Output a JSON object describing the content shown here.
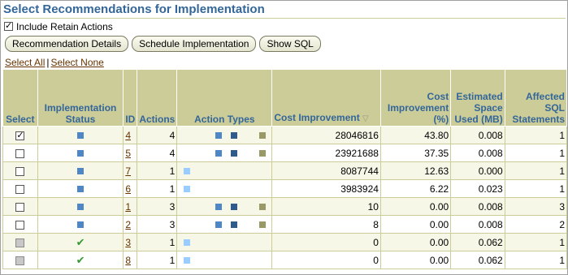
{
  "title": "Select Recommendations for Implementation",
  "retain": {
    "label": "Include Retain Actions",
    "checked": true
  },
  "buttons": {
    "details": "Recommendation Details",
    "schedule": "Schedule Implementation",
    "show_sql": "Show SQL"
  },
  "links": {
    "select_all": "Select All",
    "separator": "|",
    "select_none": "Select None"
  },
  "columns": {
    "select": "Select",
    "status": "Implementation Status",
    "id": "ID",
    "actions": "Actions",
    "action_types": "Action Types",
    "cost_improvement": "Cost Improvement",
    "cost_improvement_pct": "Cost Improvement (%)",
    "space": "Estimated Space Used (MB)",
    "affected": "Affected SQL Statements"
  },
  "rows": [
    {
      "selected": true,
      "disabled": false,
      "status": "pending",
      "id": "4",
      "actions": "4",
      "types": [
        "blue",
        "navy",
        "olive"
      ],
      "cost": "28046816",
      "pct": "43.80",
      "space": "0.008",
      "affected": "1"
    },
    {
      "selected": false,
      "disabled": false,
      "status": "pending",
      "id": "5",
      "actions": "4",
      "types": [
        "blue",
        "navy",
        "olive"
      ],
      "cost": "23921688",
      "pct": "37.35",
      "space": "0.008",
      "affected": "1"
    },
    {
      "selected": false,
      "disabled": false,
      "status": "pending",
      "id": "7",
      "actions": "1",
      "types": [
        "light"
      ],
      "cost": "8087744",
      "pct": "12.63",
      "space": "0.000",
      "affected": "1"
    },
    {
      "selected": false,
      "disabled": false,
      "status": "pending",
      "id": "6",
      "actions": "1",
      "types": [
        "light"
      ],
      "cost": "3983924",
      "pct": "6.22",
      "space": "0.023",
      "affected": "1"
    },
    {
      "selected": false,
      "disabled": false,
      "status": "pending",
      "id": "1",
      "actions": "3",
      "types": [
        "blue",
        "navy",
        "olive"
      ],
      "cost": "10",
      "pct": "0.00",
      "space": "0.008",
      "affected": "3"
    },
    {
      "selected": false,
      "disabled": false,
      "status": "pending",
      "id": "2",
      "actions": "3",
      "types": [
        "blue",
        "navy",
        "olive"
      ],
      "cost": "8",
      "pct": "0.00",
      "space": "0.008",
      "affected": "2"
    },
    {
      "selected": false,
      "disabled": true,
      "status": "implemented",
      "id": "3",
      "actions": "1",
      "types": [
        "light"
      ],
      "cost": "0",
      "pct": "0.00",
      "space": "0.062",
      "affected": "1"
    },
    {
      "selected": false,
      "disabled": true,
      "status": "implemented",
      "id": "8",
      "actions": "1",
      "types": [
        "light"
      ],
      "cost": "0",
      "pct": "0.00",
      "space": "0.062",
      "affected": "1"
    }
  ],
  "icons": {
    "pending": "blue-square-status-icon",
    "implemented": "green-checkmark-icon",
    "sort": "sort-descending-icon"
  },
  "colors": {
    "header_bg": "#cccc99",
    "header_text": "#336699",
    "link": "#663300",
    "status_blue": "#4f86c6",
    "status_green": "#339933"
  }
}
